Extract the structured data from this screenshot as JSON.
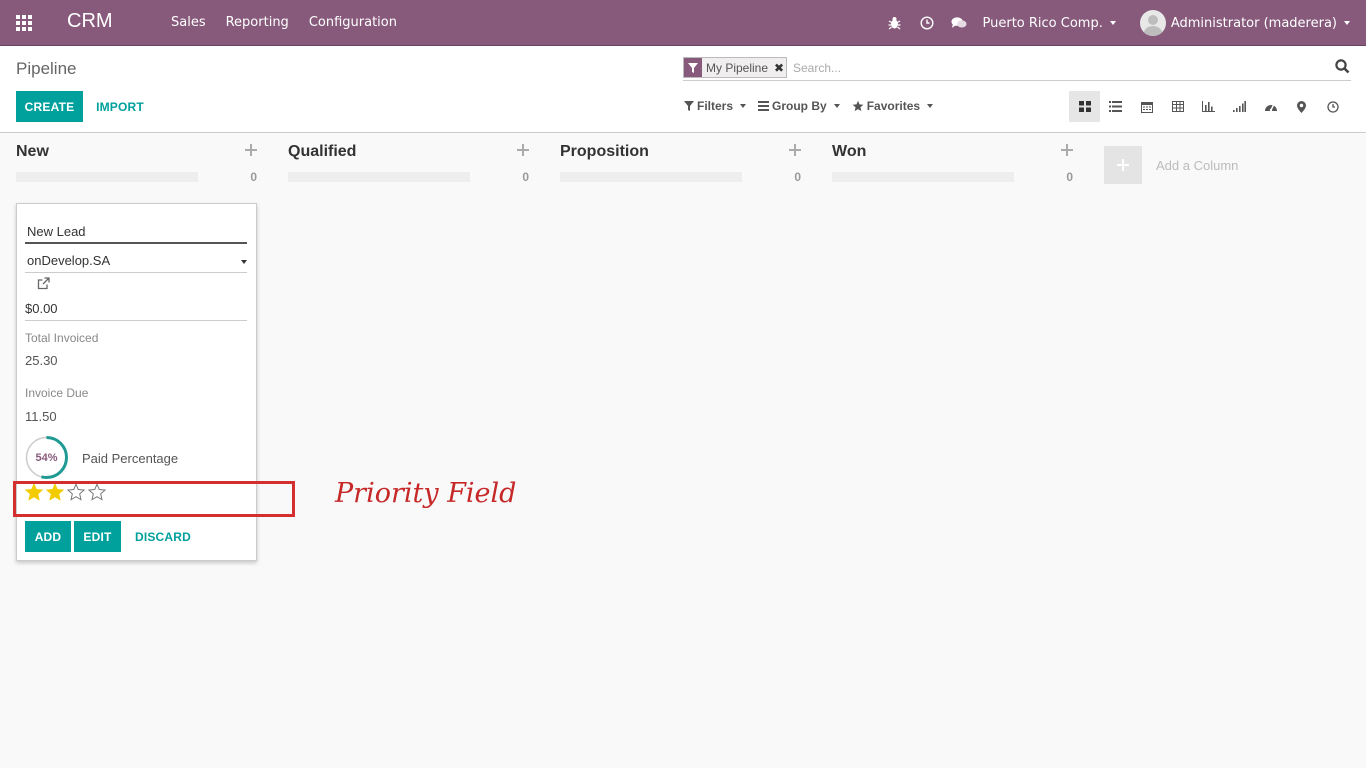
{
  "navbar": {
    "brand": "CRM",
    "menu": [
      "Sales",
      "Reporting",
      "Configuration"
    ],
    "company": "Puerto Rico Comp.",
    "user": "Administrator (maderera)",
    "icons": [
      "apps-icon",
      "bug-icon",
      "clock-icon",
      "chat-icon"
    ]
  },
  "control_panel": {
    "breadcrumb": "Pipeline",
    "create_label": "CREATE",
    "import_label": "IMPORT",
    "search": {
      "facet": "My Pipeline",
      "placeholder": "Search..."
    },
    "filters_label": "Filters",
    "groupby_label": "Group By",
    "favorites_label": "Favorites",
    "views": [
      "kanban",
      "list",
      "calendar",
      "pivot",
      "graph",
      "cohort",
      "dashboard",
      "map",
      "activity"
    ],
    "active_view": "kanban"
  },
  "kanban": {
    "columns": [
      {
        "title": "New",
        "count": "0"
      },
      {
        "title": "Qualified",
        "count": "0"
      },
      {
        "title": "Proposition",
        "count": "0"
      },
      {
        "title": "Won",
        "count": "0"
      }
    ],
    "add_column_label": "Add a Column"
  },
  "quick_create": {
    "name_value": "New Lead",
    "partner_value": "onDevelop.SA",
    "revenue_value": "$0.00",
    "total_invoiced_label": "Total Invoiced",
    "total_invoiced_value": "25.30",
    "invoice_due_label": "Invoice Due",
    "invoice_due_value": "11.50",
    "paid_percentage": "54%",
    "paid_fraction": 0.54,
    "paid_label": "Paid Percentage",
    "priority": 2,
    "priority_max": 4,
    "add_label": "ADD",
    "edit_label": "EDIT",
    "discard_label": "DISCARD"
  },
  "annotation": {
    "text": "Priority Field",
    "color": "#d32f2f"
  },
  "colors": {
    "navbar": "#875a7b",
    "primary": "#00a09d",
    "star": "#f3cc00"
  }
}
